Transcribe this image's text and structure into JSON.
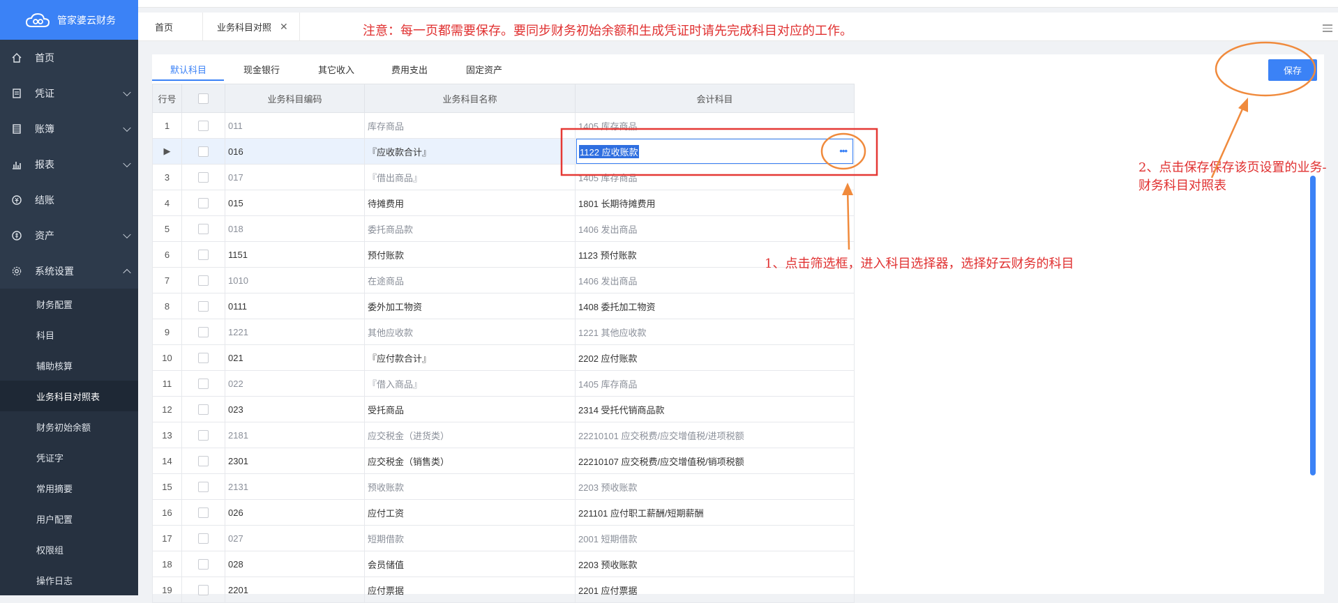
{
  "brand": {
    "name": "管家婆云财务"
  },
  "sidebar": {
    "items": [
      {
        "label": "首页",
        "icon": "home-icon"
      },
      {
        "label": "凭证",
        "icon": "voucher-icon"
      },
      {
        "label": "账簿",
        "icon": "ledger-icon"
      },
      {
        "label": "报表",
        "icon": "report-icon"
      },
      {
        "label": "结账",
        "icon": "checkout-icon"
      },
      {
        "label": "资产",
        "icon": "asset-icon"
      },
      {
        "label": "系统设置",
        "icon": "settings-icon"
      }
    ],
    "sub_items": [
      "财务配置",
      "科目",
      "辅助核算",
      "业务科目对照表",
      "财务初始余额",
      "凭证字",
      "常用摘要",
      "用户配置",
      "权限组",
      "操作日志"
    ]
  },
  "tabs": {
    "home": "首页",
    "current": "业务科目对照",
    "close": "✕"
  },
  "notice": "注意：每一页都需要保存。要同步财务初始余额和生成凭证时请先完成科目对应的工作。",
  "subtabs": [
    "默认科目",
    "现金银行",
    "其它收入",
    "费用支出",
    "固定资产"
  ],
  "save_label": "保存",
  "table": {
    "headers": [
      "行号",
      "",
      "业务科目编码",
      "业务科目名称",
      "会计科目"
    ],
    "rows": [
      {
        "no": "1",
        "code": "011",
        "name": "库存商品",
        "account": "1405 库存商品"
      },
      {
        "no": "▶",
        "code": "016",
        "name": "『应收款合计』",
        "account": "1122 应收账款"
      },
      {
        "no": "3",
        "code": "017",
        "name": "『借出商品』",
        "account": "1405 库存商品"
      },
      {
        "no": "4",
        "code": "015",
        "name": "待摊费用",
        "account": "1801 长期待摊费用"
      },
      {
        "no": "5",
        "code": "018",
        "name": "委托商品款",
        "account": "1406 发出商品"
      },
      {
        "no": "6",
        "code": "1151",
        "name": "预付账款",
        "account": "1123 预付账款"
      },
      {
        "no": "7",
        "code": "1010",
        "name": "在途商品",
        "account": "1406 发出商品"
      },
      {
        "no": "8",
        "code": "0111",
        "name": "委外加工物资",
        "account": "1408 委托加工物资"
      },
      {
        "no": "9",
        "code": "1221",
        "name": "其他应收款",
        "account": "1221 其他应收款"
      },
      {
        "no": "10",
        "code": "021",
        "name": "『应付款合计』",
        "account": "2202 应付账款"
      },
      {
        "no": "11",
        "code": "022",
        "name": "『借入商品』",
        "account": "1405 库存商品"
      },
      {
        "no": "12",
        "code": "023",
        "name": "受托商品",
        "account": "2314 受托代销商品款"
      },
      {
        "no": "13",
        "code": "2181",
        "name": "应交税金（进货类）",
        "account": "22210101 应交税费/应交增值税/进项税额"
      },
      {
        "no": "14",
        "code": "2301",
        "name": "应交税金（销售类）",
        "account": "22210107 应交税费/应交增值税/销项税额"
      },
      {
        "no": "15",
        "code": "2131",
        "name": "预收账款",
        "account": "2203 预收账款"
      },
      {
        "no": "16",
        "code": "026",
        "name": "应付工资",
        "account": "221101 应付职工薪酬/短期薪酬"
      },
      {
        "no": "17",
        "code": "027",
        "name": "短期借款",
        "account": "2001 短期借款"
      },
      {
        "no": "18",
        "code": "028",
        "name": "会员储值",
        "account": "2203 预收账款"
      },
      {
        "no": "19",
        "code": "2201",
        "name": "应付票据",
        "account": "2201 应付票据"
      }
    ]
  },
  "annotations": {
    "step1": "1、点击筛选框，进入科目选择器，选择好云财务的科目",
    "step2": "2、点击保存保存该页设置的业务-财务科目对照表"
  },
  "colors": {
    "accent": "#3b82f6",
    "sidebar": "#2d3a4b",
    "annotation": "#e03030",
    "highlight_circle": "#f08a3c"
  }
}
